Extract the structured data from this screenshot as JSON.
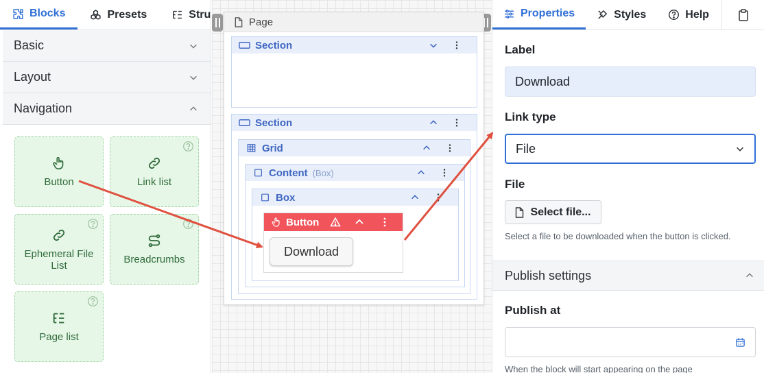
{
  "left_panel": {
    "tabs": [
      {
        "label": "Blocks",
        "icon": "puzzle-icon",
        "active": true
      },
      {
        "label": "Presets",
        "icon": "presets-icon",
        "active": false
      },
      {
        "label": "Structure",
        "icon": "tree-icon",
        "active": false
      }
    ],
    "sections": [
      {
        "label": "Basic",
        "expanded": false
      },
      {
        "label": "Layout",
        "expanded": false
      },
      {
        "label": "Navigation",
        "expanded": true
      }
    ],
    "blocks": [
      {
        "label": "Button",
        "icon": "hand-pointer-icon",
        "help": false
      },
      {
        "label": "Link list",
        "icon": "link-icon",
        "help": true
      },
      {
        "label": "Ephemeral File List",
        "icon": "link-icon",
        "help": true
      },
      {
        "label": "Breadcrumbs",
        "icon": "route-icon",
        "help": true
      },
      {
        "label": "Page list",
        "icon": "list-tree-icon",
        "help": true
      }
    ]
  },
  "canvas": {
    "page_label": "Page",
    "section1_label": "Section",
    "section2_label": "Section",
    "grid_label": "Grid",
    "content_label": "Content",
    "content_sub": "(Box)",
    "box_label": "Box",
    "button_label": "Button",
    "download_label": "Download",
    "selected_color": "#f1545b"
  },
  "right_panel": {
    "tabs": [
      {
        "label": "Properties",
        "icon": "sliders-icon",
        "active": true
      },
      {
        "label": "Styles",
        "icon": "brush-icon",
        "active": false
      },
      {
        "label": "Help",
        "icon": "help-circle-icon",
        "active": false
      }
    ],
    "label_field": {
      "label": "Label",
      "value": "Download"
    },
    "link_type": {
      "label": "Link type",
      "value": "File"
    },
    "file": {
      "label": "File",
      "button": "Select file...",
      "hint": "Select a file to be downloaded when the button is clicked."
    },
    "publish": {
      "section": "Publish settings",
      "publish_at_label": "Publish at",
      "publish_at_value": "",
      "hint": "When the block will start appearing on the page"
    }
  },
  "accent_color": "#2f6fd6",
  "arrow_color": "#e0503f"
}
